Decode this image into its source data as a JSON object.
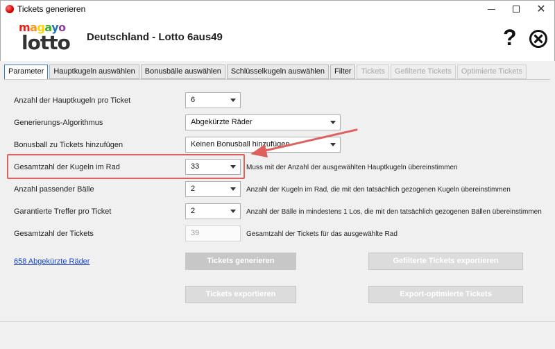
{
  "window": {
    "title": "Tickets generieren",
    "controls": {
      "minimize": "minimize",
      "maximize": "maximize",
      "close": "✕"
    }
  },
  "header": {
    "logo_top": "magayo",
    "logo_bottom": "lotto",
    "heading": "Deutschland - Lotto 6aus49",
    "help_glyph": "?"
  },
  "tabs": [
    {
      "label": "Parameter",
      "state": "active"
    },
    {
      "label": "Hauptkugeln auswählen",
      "state": "normal"
    },
    {
      "label": "Bonusbälle auswählen",
      "state": "normal"
    },
    {
      "label": "Schlüsselkugeln auswählen",
      "state": "normal"
    },
    {
      "label": "Filter",
      "state": "normal"
    },
    {
      "label": "Tickets",
      "state": "disabled"
    },
    {
      "label": "Gefilterte Tickets",
      "state": "disabled"
    },
    {
      "label": "Optimierte Tickets",
      "state": "disabled"
    }
  ],
  "form": {
    "main_balls": {
      "label": "Anzahl der Hauptkugeln pro Ticket",
      "value": "6"
    },
    "algorithm": {
      "label": "Generierungs-Algorithmus",
      "value": "Abgekürzte Räder"
    },
    "bonus": {
      "label": "Bonusball zu Tickets hinzufügen",
      "value": "Keinen Bonusball hinzufügen"
    },
    "wheel_total": {
      "label": "Gesamtzahl der Kugeln im Rad",
      "value": "33",
      "hint": "Muss mit der Anzahl der ausgewählten Hauptkugeln übereinstimmen"
    },
    "matching": {
      "label": "Anzahl passender Bälle",
      "value": "2",
      "hint": "Anzahl der Kugeln im Rad, die mit den tatsächlich gezogenen Kugeln übereinstimmen"
    },
    "guaranteed": {
      "label": "Garantierte Treffer pro Ticket",
      "value": "2",
      "hint": "Anzahl der Bälle in mindestens 1 Los, die mit den tatsächlich gezogenen Bällen übereinstimmen"
    },
    "ticket_total": {
      "label": "Gesamtzahl der Tickets",
      "value": "39",
      "hint": "Gesamtzahl der Tickets für das ausgewählte Rad"
    }
  },
  "link": {
    "label": "658 Abgekürzte Räder"
  },
  "buttons": {
    "generate": "Tickets generieren",
    "export_filtered": "Gefilterte Tickets exportieren",
    "export": "Tickets exportieren",
    "export_optimized": "Export-optimierte Tickets"
  },
  "colors": {
    "annotation": "#e0605d",
    "link": "#1a44cc",
    "active_tab_border": "#3c7fb1"
  }
}
